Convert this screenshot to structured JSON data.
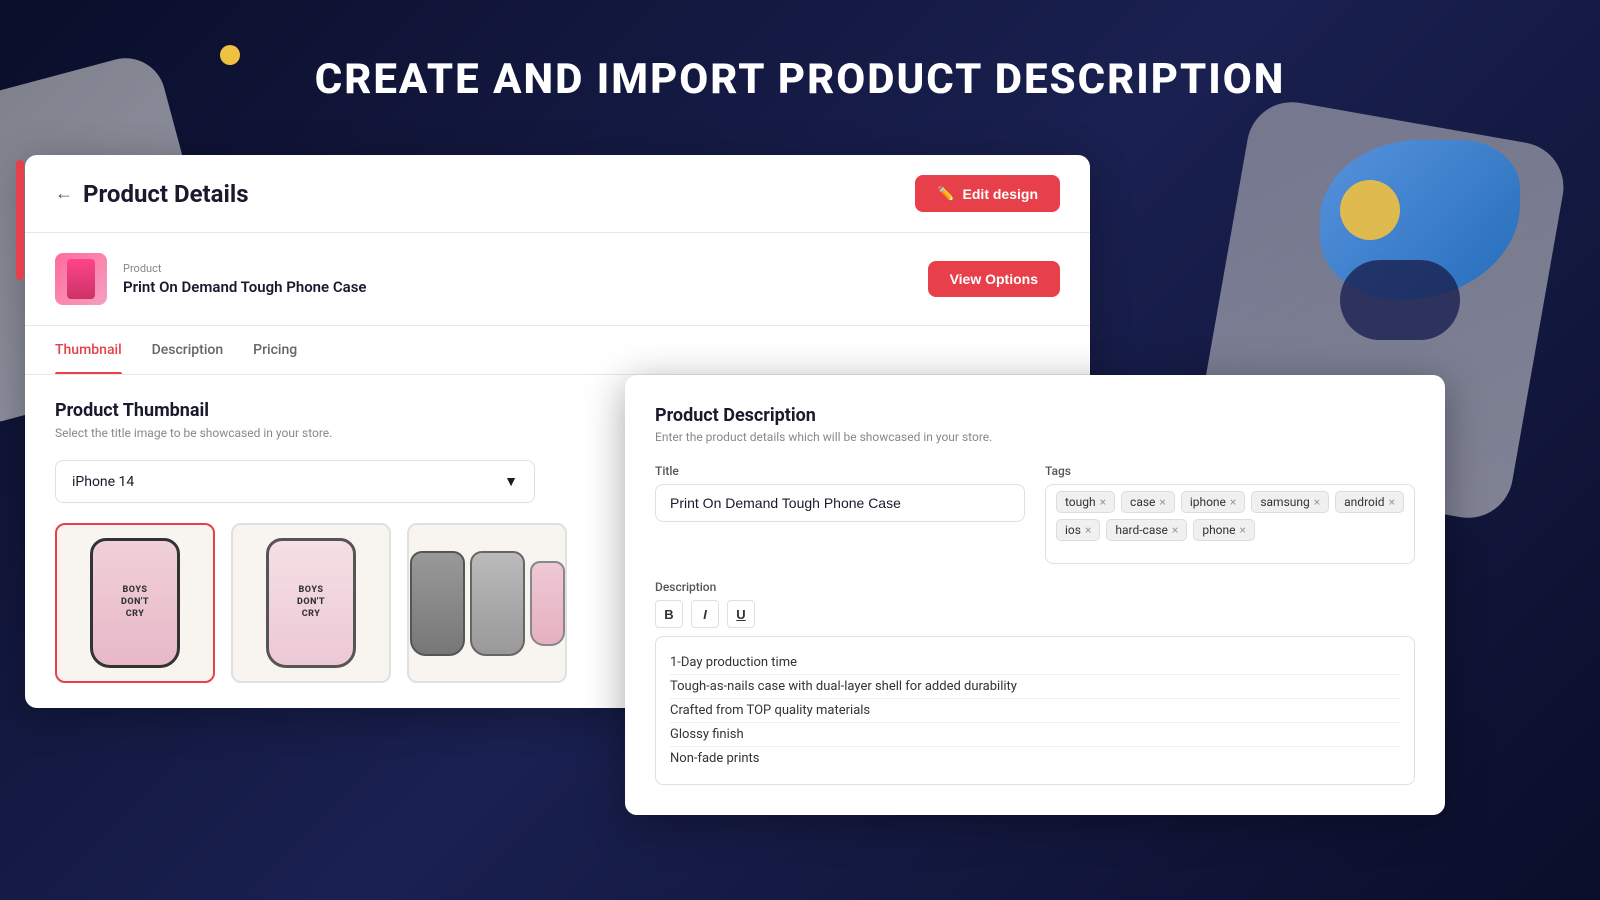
{
  "page": {
    "title": "CREATE AND IMPORT PRODUCT DESCRIPTION"
  },
  "header": {
    "back_label": "←",
    "title": "Product Details",
    "edit_design_btn": "Edit design"
  },
  "product_row": {
    "label": "Product",
    "name": "Print On Demand Tough Phone Case",
    "view_options_btn": "View Options"
  },
  "tabs": [
    {
      "label": "Thumbnail",
      "active": true
    },
    {
      "label": "Description",
      "active": false
    },
    {
      "label": "Pricing",
      "active": false
    }
  ],
  "thumbnail_section": {
    "title": "Product Thumbnail",
    "subtitle": "Select the title image to be showcased in your store.",
    "dropdown_value": "iPhone 14",
    "dropdown_icon": "▼",
    "images": [
      {
        "id": "thumb-1",
        "selected": true
      },
      {
        "id": "thumb-2",
        "selected": false
      },
      {
        "id": "thumb-3",
        "selected": false
      }
    ]
  },
  "description_panel": {
    "title": "Product Description",
    "subtitle": "Enter the product details which will be showcased in your store.",
    "title_label": "Title",
    "title_value": "Print On Demand Tough Phone Case",
    "tags_label": "Tags",
    "tags": [
      {
        "label": "tough"
      },
      {
        "label": "case"
      },
      {
        "label": "iphone"
      },
      {
        "label": "samsung"
      },
      {
        "label": "android"
      },
      {
        "label": "ios"
      },
      {
        "label": "hard-case"
      },
      {
        "label": "phone"
      }
    ],
    "description_label": "Description",
    "toolbar": {
      "bold": "B",
      "italic": "I",
      "underline": "U"
    },
    "description_lines": [
      "1-Day production time",
      "Tough-as-nails case with dual-layer shell for added durability",
      "Crafted from TOP quality materials",
      "Glossy finish",
      "Non-fade prints"
    ]
  }
}
